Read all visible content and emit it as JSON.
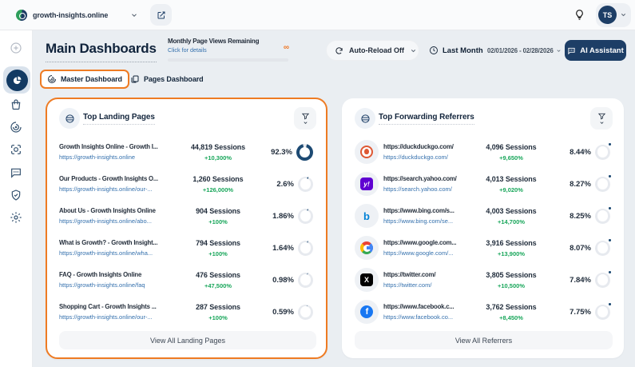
{
  "colors": {
    "accent_orange": "#ee7b23",
    "navy": "#1d3e66",
    "green": "#18a65a",
    "link_blue": "#3470ad"
  },
  "topbar": {
    "site_name": "growth-insights.online",
    "avatar_initials": "TS"
  },
  "header": {
    "title": "Main Dashboards",
    "monthly_label": "Monthly Page Views Remaining",
    "monthly_link": "Click for details",
    "monthly_value": "∞",
    "auto_reload": "Auto-Reload Off",
    "period": "Last Month",
    "date_range": "02/01/2026 - 02/28/2026",
    "ai_assistant": "AI Assistant"
  },
  "tabs": [
    {
      "label": "Master Dashboard"
    },
    {
      "label": "Pages Dashboard"
    }
  ],
  "sidebar": {
    "items": [
      "plus",
      "pie-dashboard",
      "bag",
      "spiral",
      "scan",
      "chat",
      "shield",
      "gear"
    ],
    "active_index": 1
  },
  "landing_pages": {
    "title": "Top Landing Pages",
    "view_all": "View All Landing Pages",
    "rows": [
      {
        "title": "Growth Insights Online - Growth I...",
        "url": "https://growth-insights.online",
        "sessions": "44,819 Sessions",
        "change": "+10,300%",
        "percent": "92.3%",
        "percent_value": 92.3
      },
      {
        "title": "Our Products - Growth Insights O...",
        "url": "https://growth-insights.online/our-...",
        "sessions": "1,260 Sessions",
        "change": "+126,000%",
        "percent": "2.6%",
        "percent_value": 2.6
      },
      {
        "title": "About Us - Growth Insights Online",
        "url": "https://growth-insights.online/abo...",
        "sessions": "904 Sessions",
        "change": "+100%",
        "percent": "1.86%",
        "percent_value": 1.86
      },
      {
        "title": "What is Growth? - Growth Insight...",
        "url": "https://growth-insights.online/wha...",
        "sessions": "794 Sessions",
        "change": "+100%",
        "percent": "1.64%",
        "percent_value": 1.64
      },
      {
        "title": "FAQ - Growth Insights Online",
        "url": "https://growth-insights.online/faq",
        "sessions": "476 Sessions",
        "change": "+47,500%",
        "percent": "0.98%",
        "percent_value": 0.98
      },
      {
        "title": "Shopping Cart - Growth Insights ...",
        "url": "https://growth-insights.online/our-...",
        "sessions": "287 Sessions",
        "change": "+100%",
        "percent": "0.59%",
        "percent_value": 0.59
      }
    ]
  },
  "referrers": {
    "title": "Top Forwarding Referrers",
    "view_all": "View All Referrers",
    "rows": [
      {
        "icon": "duckduckgo",
        "title": "https://duckduckgo.com/",
        "url": "https://duckduckgo.com/",
        "sessions": "4,096 Sessions",
        "change": "+9,650%",
        "percent": "8.44%",
        "percent_value": 8.44
      },
      {
        "icon": "yahoo",
        "title": "https://search.yahoo.com/",
        "url": "https://search.yahoo.com/",
        "sessions": "4,013 Sessions",
        "change": "+9,020%",
        "percent": "8.27%",
        "percent_value": 8.27
      },
      {
        "icon": "bing",
        "title": "https://www.bing.com/s...",
        "url": "https://www.bing.com/se...",
        "sessions": "4,003 Sessions",
        "change": "+14,700%",
        "percent": "8.25%",
        "percent_value": 8.25
      },
      {
        "icon": "google",
        "title": "https://www.google.com...",
        "url": "https://www.google.com/...",
        "sessions": "3,916 Sessions",
        "change": "+13,900%",
        "percent": "8.07%",
        "percent_value": 8.07
      },
      {
        "icon": "twitter",
        "title": "https://twitter.com/",
        "url": "https://twitter.com/",
        "sessions": "3,805 Sessions",
        "change": "+10,500%",
        "percent": "7.84%",
        "percent_value": 7.84
      },
      {
        "icon": "facebook",
        "title": "https://www.facebook.c...",
        "url": "https://www.facebook.co...",
        "sessions": "3,762 Sessions",
        "change": "+8,450%",
        "percent": "7.75%",
        "percent_value": 7.75
      }
    ]
  }
}
